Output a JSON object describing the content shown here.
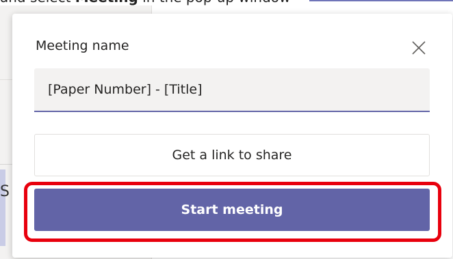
{
  "background": {
    "caption_prefix": "and select ",
    "caption_bold": "Meeting",
    "caption_suffix": " in the pop-up window",
    "partial_letter": "S"
  },
  "dialog": {
    "title": "Meeting name",
    "close_icon": "close-icon",
    "name_input": {
      "value": "[Paper Number] - [Title]",
      "placeholder": ""
    },
    "get_link_label": "Get a link to share",
    "start_meeting_label": "Start meeting"
  },
  "colors": {
    "accent": "#6264a7",
    "highlight": "#e8000d",
    "input_bg": "#f3f2f1"
  }
}
